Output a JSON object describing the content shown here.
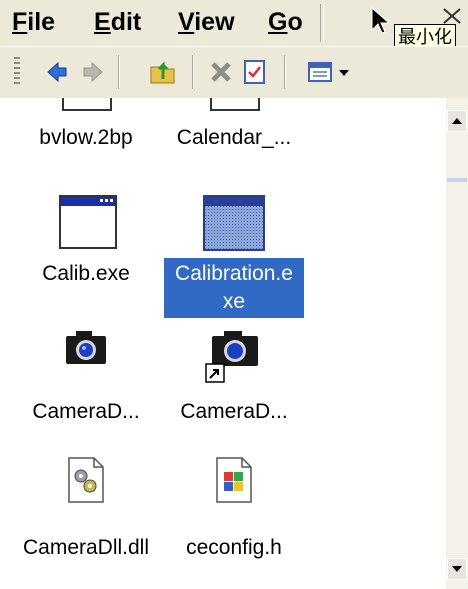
{
  "menu": {
    "file": {
      "mnemonic": "F",
      "rest": "ile"
    },
    "edit": {
      "mnemonic": "E",
      "rest": "dit"
    },
    "view": {
      "mnemonic": "V",
      "rest": "iew"
    },
    "go": {
      "mnemonic": "G",
      "rest": "o"
    }
  },
  "tooltip": "最小化",
  "toolbar": {
    "icons": [
      "back-icon",
      "forward-icon",
      "up-folder-icon",
      "delete-icon",
      "properties-icon",
      "view-menu-icon"
    ]
  },
  "files": [
    {
      "name": "bvlow.2bp",
      "icon": "generic-file-icon"
    },
    {
      "name": "Calendar_...",
      "icon": "generic-file-icon"
    },
    {
      "name": "Calib.exe",
      "icon": "window-app-icon"
    },
    {
      "name_line1": "Calibration.e",
      "name_line2": "xe",
      "icon": "window-app-icon",
      "selected": true
    },
    {
      "name": "CameraD...",
      "icon": "camera-icon"
    },
    {
      "name": "CameraD...",
      "icon": "camera-shortcut-icon"
    },
    {
      "name": "CameraDll.dll",
      "icon": "dll-gears-icon"
    },
    {
      "name": "ceconfig.h",
      "icon": "windows-logo-file-icon"
    }
  ],
  "colors": {
    "selection": "#316ac5",
    "chrome": "#ece9d8",
    "tooltip_bg": "#ffffe1"
  }
}
